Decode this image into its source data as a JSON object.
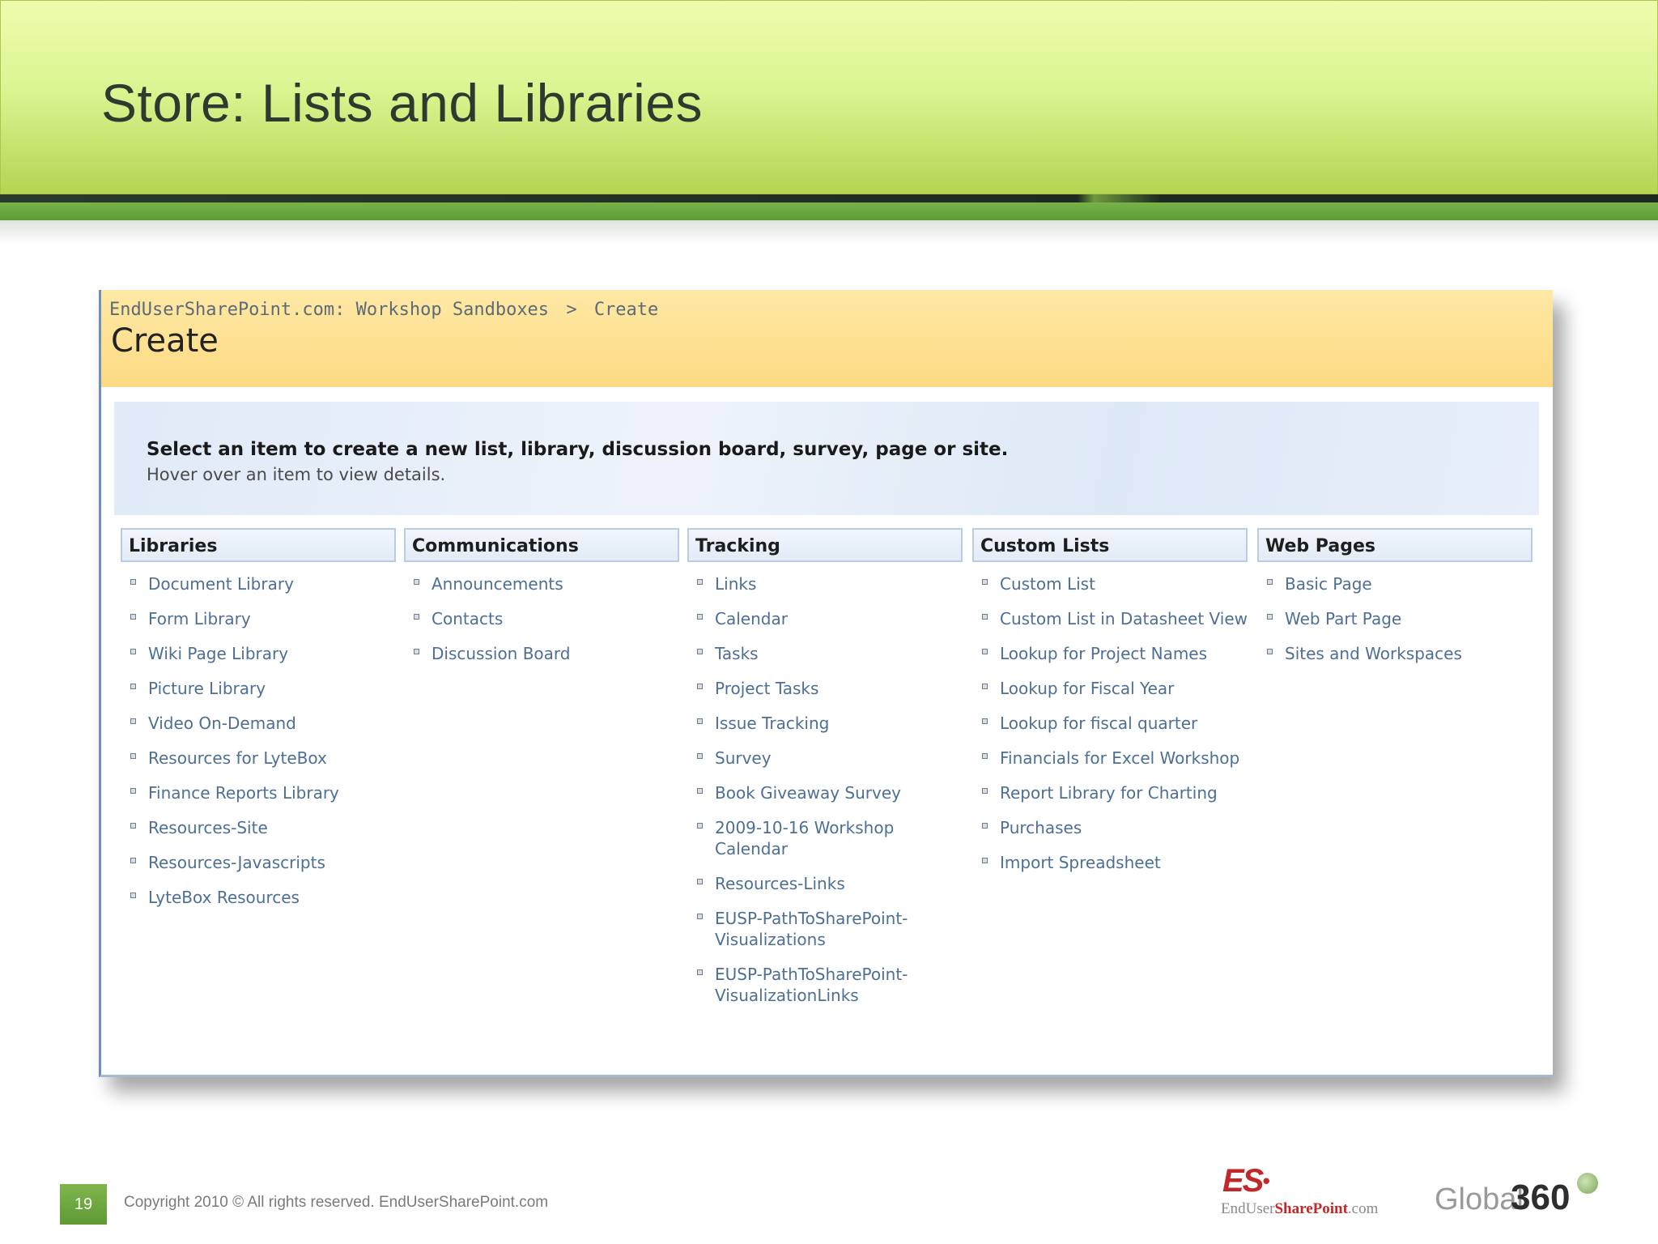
{
  "slide": {
    "title": "Store: Lists and Libraries",
    "page_number": "19",
    "copyright": "Copyright 2010 ©  All rights reserved. EndUserSharePoint.com"
  },
  "sharepoint": {
    "breadcrumb": {
      "site": "EndUserSharePoint.com: Workshop Sandboxes",
      "separator": ">",
      "current": "Create"
    },
    "page_title": "Create",
    "intro": {
      "main": "Select an item to create a new list, library, discussion board, survey, page or site.",
      "sub": "Hover over an item to view details."
    },
    "columns": [
      {
        "title": "Libraries",
        "items": [
          "Document Library",
          "Form Library",
          "Wiki Page Library",
          "Picture Library",
          "Video On-Demand",
          "Resources for LyteBox",
          "Finance Reports Library",
          "Resources-Site",
          "Resources-Javascripts",
          "LyteBox Resources"
        ]
      },
      {
        "title": "Communications",
        "items": [
          "Announcements",
          "Contacts",
          "Discussion Board"
        ]
      },
      {
        "title": "Tracking",
        "items": [
          "Links",
          "Calendar",
          "Tasks",
          "Project Tasks",
          "Issue Tracking",
          "Survey",
          "Book Giveaway Survey",
          "2009-10-16 Workshop Calendar",
          "Resources-Links",
          "EUSP-PathToSharePoint-Visualizations",
          "EUSP-PathToSharePoint-VisualizationLinks"
        ]
      },
      {
        "title": "Custom Lists",
        "items": [
          "Custom List",
          "Custom List in Datasheet View",
          "Lookup for Project Names",
          "Lookup for Fiscal Year",
          "Lookup for fiscal quarter",
          "Financials for Excel Workshop",
          "Report Library for Charting",
          "Purchases",
          "Import Spreadsheet"
        ]
      },
      {
        "title": "Web Pages",
        "items": [
          "Basic Page",
          "Web Part Page",
          "Sites and Workspaces"
        ]
      }
    ]
  },
  "logos": {
    "es_mark": "ES",
    "es_text_prefix": "EndUser",
    "es_text_brand": "SharePoint",
    "es_text_suffix": ".com",
    "g360_global": "Global",
    "g360_num": "360"
  },
  "colors": {
    "header_green": "#dcf593",
    "sp_header_yellow": "#fdda82",
    "link_blue": "#4e6f95",
    "accent_green": "#5f9a36",
    "es_red": "#c0282a"
  }
}
